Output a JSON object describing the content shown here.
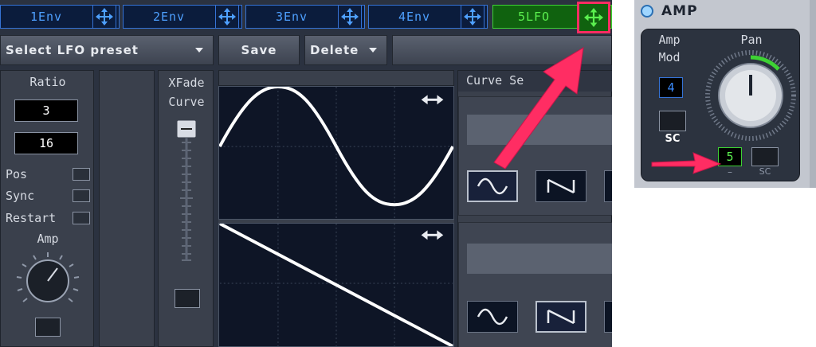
{
  "tabs": [
    {
      "label": "1Env",
      "active": false
    },
    {
      "label": "2Env",
      "active": false
    },
    {
      "label": "3Env",
      "active": false
    },
    {
      "label": "4Env",
      "active": false
    },
    {
      "label": "5LFO",
      "active": true
    }
  ],
  "preset_bar": {
    "select_label": "Select LFO preset",
    "save_label": "Save",
    "delete_label": "Delete"
  },
  "ratio": {
    "label": "Ratio",
    "numerator": "3",
    "denominator": "16"
  },
  "toggles": [
    {
      "label": "Pos"
    },
    {
      "label": "Sync"
    },
    {
      "label": "Restart"
    }
  ],
  "amp_knob_label": "Amp",
  "xfade": {
    "label_line1": "XFade",
    "label_line2": "Curve"
  },
  "curve_section": {
    "title": "Curve Se"
  },
  "amp_module": {
    "title": "AMP",
    "amp_mod_line1": "Amp",
    "amp_mod_line2": "Mod",
    "amp_mod_value": "4",
    "sc_label": "SC",
    "pan_label": "Pan",
    "pan_value": "5",
    "pan_dash": "–",
    "pan_sc_label": "SC"
  },
  "colors": {
    "accent_blue": "#3573d6",
    "active_green": "#3ed234",
    "highlight_pink": "#ff2d63"
  },
  "icons": [
    "move-arrows-icon",
    "caret-down-icon",
    "horizontal-resize-icon",
    "sine-wave-icon",
    "sawtooth-wave-icon",
    "power-led-icon"
  ]
}
